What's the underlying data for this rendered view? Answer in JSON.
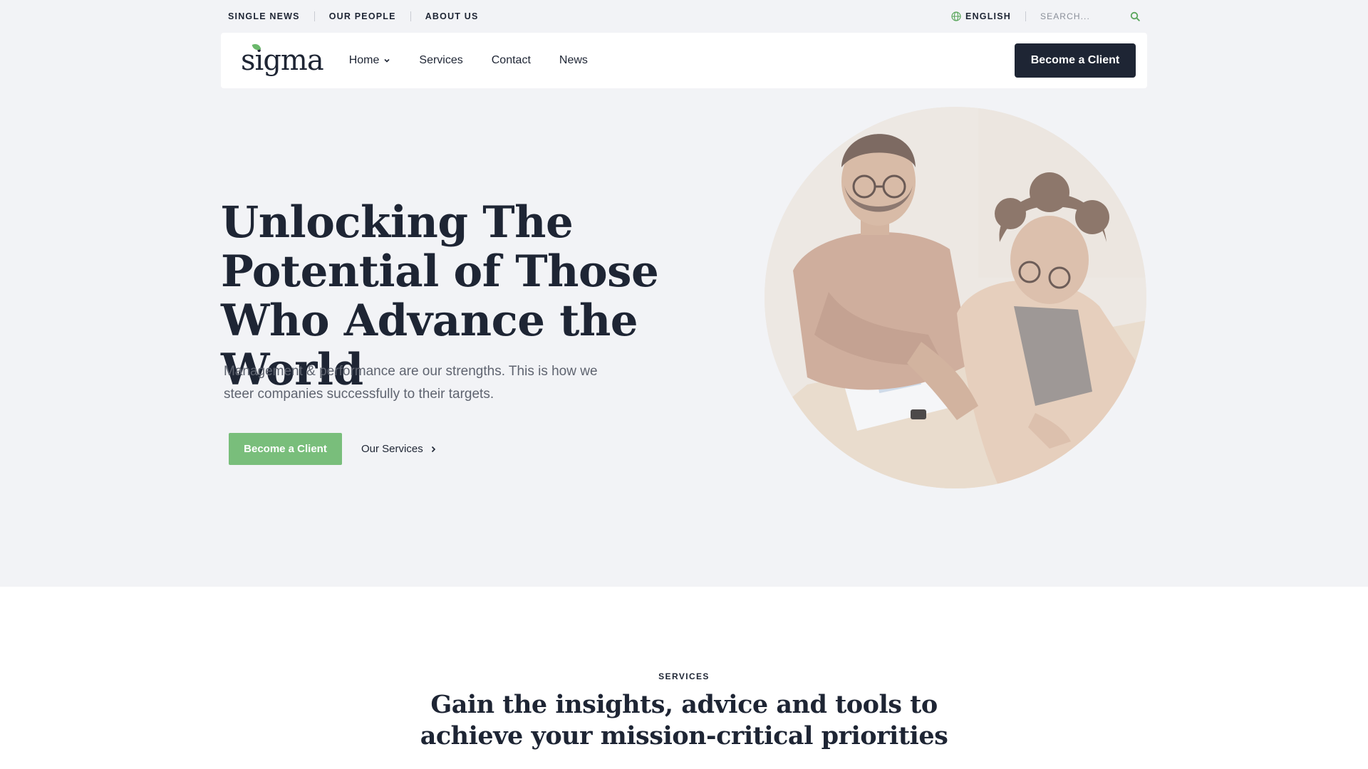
{
  "topbar": {
    "links": [
      "SINGLE NEWS",
      "OUR PEOPLE",
      "ABOUT US"
    ],
    "language": "ENGLISH",
    "search_placeholder": "SEARCH..."
  },
  "header": {
    "logo": "sigma",
    "nav": [
      "Home",
      "Services",
      "Contact",
      "News"
    ],
    "cta": "Become a Client"
  },
  "hero": {
    "title": "Unlocking The Potential of Those Who Advance the World",
    "subtitle": "Management & performance are our strengths. This is how we steer companies successfully to their targets.",
    "primary_button": "Become a Client",
    "secondary_link": "Our Services"
  },
  "services": {
    "eyebrow": "SERVICES",
    "title": "Gain the insights, advice and tools to achieve your mission-critical priorities"
  },
  "colors": {
    "navy": "#1e2534",
    "green": "#79be7b",
    "background": "#f2f3f6"
  }
}
